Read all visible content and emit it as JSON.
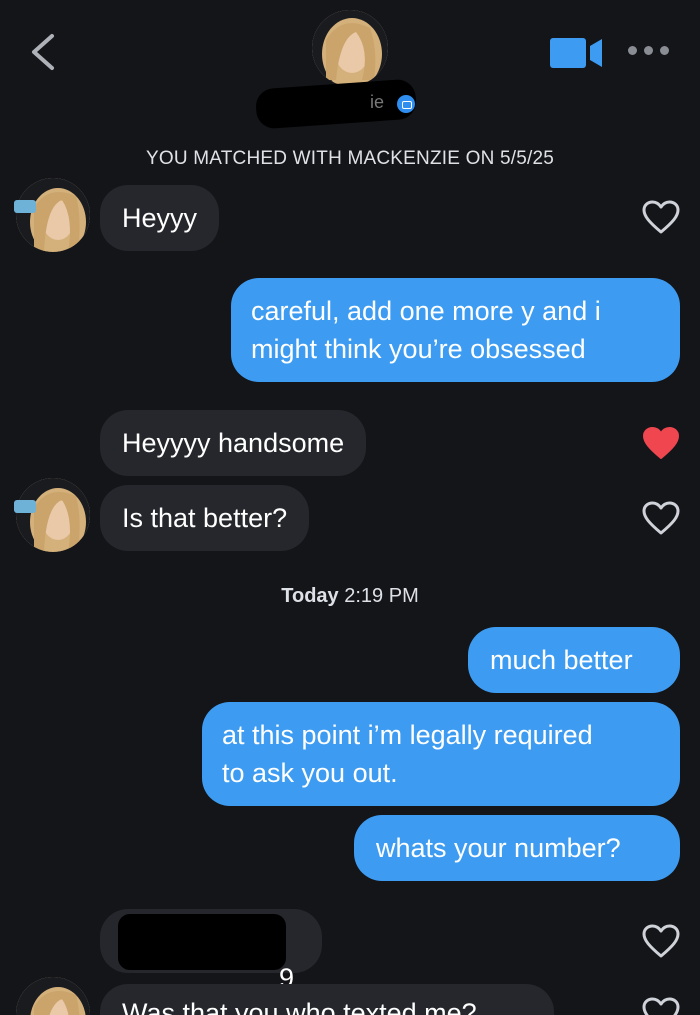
{
  "header": {
    "contact_name_visible_suffix": "ie",
    "back_icon": "chevron-left-icon",
    "video_icon": "video-camera-icon",
    "more_icon": "more-dots-icon",
    "verified_icon": "verified-badge-icon"
  },
  "match_banner": "YOU MATCHED WITH MACKENZIE ON 5/5/25",
  "messages": [
    {
      "from": "them",
      "text": "Heyyy",
      "liked": false
    },
    {
      "from": "me",
      "text": "careful, add one more y and i\nmight think you’re obsessed"
    },
    {
      "from": "them",
      "text": "Heyyyy handsome",
      "liked": true
    },
    {
      "from": "them",
      "text": "Is that better?",
      "liked": false
    },
    {
      "from": "me",
      "text": "much better"
    },
    {
      "from": "me",
      "text": "at this point i’m legally required\nto ask you out."
    },
    {
      "from": "me",
      "text": "whats your number?"
    },
    {
      "from": "them",
      "text": "9",
      "liked": false,
      "redacted": true
    },
    {
      "from": "them",
      "text": "Was that you who texted me?",
      "liked": false
    }
  ],
  "timestamp": {
    "day": "Today",
    "time": "2:19 PM"
  },
  "colors": {
    "background": "#141519",
    "outgoing_bubble": "#3d9cf1",
    "incoming_bubble": "#25272c",
    "like_active": "#f0464f",
    "like_inactive": "#cfd2d8"
  }
}
